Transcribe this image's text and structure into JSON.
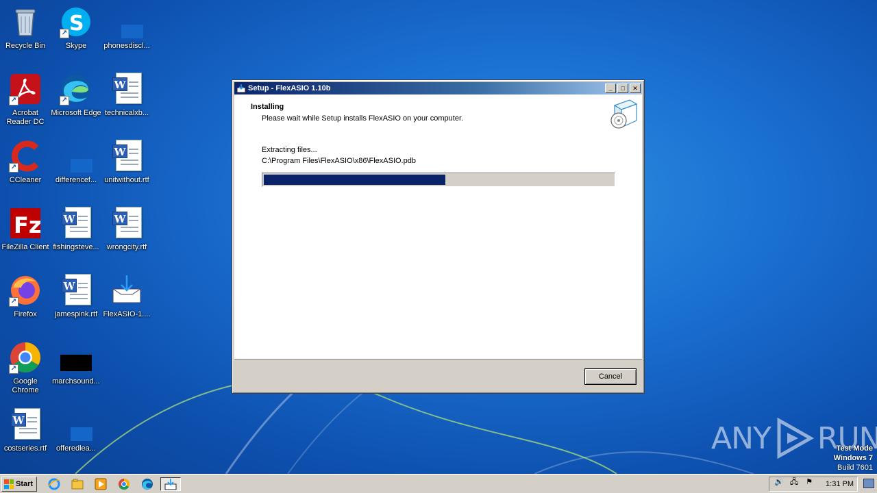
{
  "desktop": {
    "icons": [
      {
        "label": "Recycle Bin"
      },
      {
        "label": "Skype"
      },
      {
        "label": "phonesdiscl..."
      },
      {
        "label": "Acrobat Reader DC"
      },
      {
        "label": "Microsoft Edge"
      },
      {
        "label": "technicalxb..."
      },
      {
        "label": "CCleaner"
      },
      {
        "label": "differencef..."
      },
      {
        "label": "unitwithout.rtf"
      },
      {
        "label": "FileZilla Client"
      },
      {
        "label": "fishingsteve..."
      },
      {
        "label": "wrongcity.rtf"
      },
      {
        "label": "Firefox"
      },
      {
        "label": "jamespink.rtf"
      },
      {
        "label": "FlexASIO-1...."
      },
      {
        "label": "Google Chrome"
      },
      {
        "label": "marchsound..."
      },
      {
        "label": "costseries.rtf"
      },
      {
        "label": "offeredlea..."
      }
    ]
  },
  "window": {
    "title": "Setup - FlexASIO 1.10b",
    "minimize": "_",
    "maximize": "□",
    "close": "✕",
    "header_title": "Installing",
    "header_subtitle": "Please wait while Setup installs FlexASIO on your computer.",
    "status_line": "Extracting files...",
    "current_file": "C:\\Program Files\\FlexASIO\\x86\\FlexASIO.pdb",
    "progress_fraction": 0.52,
    "cancel_label": "Cancel"
  },
  "watermark": {
    "text_left": "ANY",
    "text_right": "RUN"
  },
  "os_info": {
    "line1": "Test Mode",
    "line2": "Windows 7",
    "line3": "Build 7601"
  },
  "taskbar": {
    "start_label": "Start",
    "clock": "1:31 PM"
  }
}
